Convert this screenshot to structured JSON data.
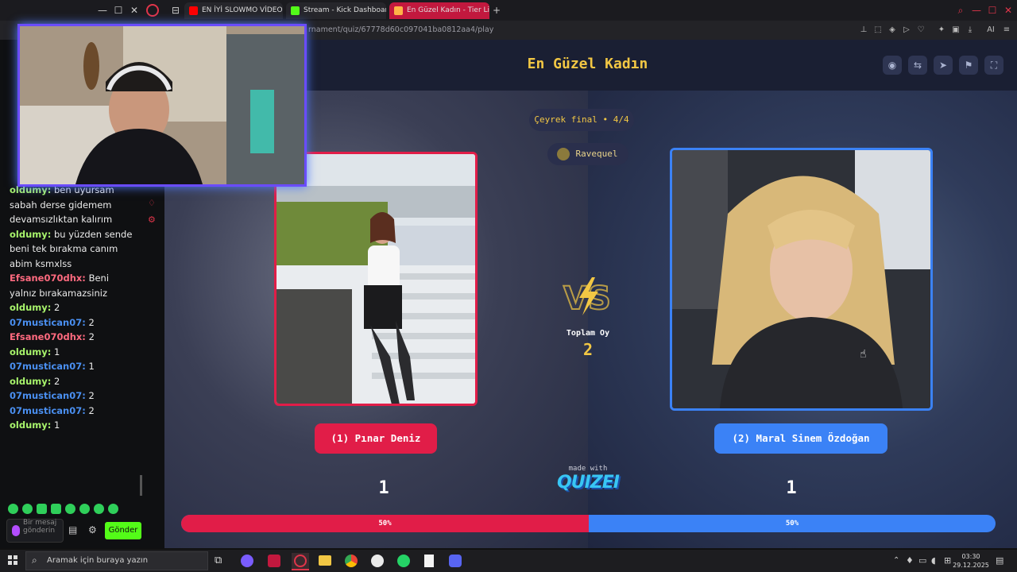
{
  "browser": {
    "tabs": [
      {
        "label": "EN İYİ SLOWMO VİDEOLA",
        "icon_color": "#ff0000"
      },
      {
        "label": "Stream - Kick Dashboard",
        "icon_color": "#53fc18"
      },
      {
        "label": "En Güzel Kadın - Tier List,",
        "icon_color": "#e11d48"
      }
    ],
    "url": "rnament/quiz/67778d60c097041ba0812aa4/play",
    "ai_label": "AI"
  },
  "quiz": {
    "title": "En Güzel Kadın",
    "round_label": "Çeyrek final • 4/4",
    "user_label": "Ravequel",
    "vs_label": "VS",
    "total_votes_label": "Toplam Oy",
    "total_votes": "2",
    "left": {
      "name": "(1) Pınar Deniz",
      "votes": "1",
      "percent": "50%",
      "color": "#e11d48"
    },
    "right": {
      "name": "(2) Maral Sinem Özdoğan",
      "votes": "1",
      "percent": "50%",
      "color": "#3b82f6"
    },
    "made_with": "made with",
    "brand": "QUIZEI",
    "progress_left_fraction": 0.5
  },
  "chat": {
    "messages": [
      {
        "user": "oldumy:",
        "text": "ben uyursam",
        "color": "green"
      },
      {
        "user": "",
        "text": "sabah derse gidemem",
        "color": "green"
      },
      {
        "user": "",
        "text": "devamsızlıktan kalırım",
        "color": "green"
      },
      {
        "user": "oldumy:",
        "text": "bu yüzden sende",
        "color": "green"
      },
      {
        "user": "",
        "text": "beni tek bırakma canım",
        "color": "green"
      },
      {
        "user": "",
        "text": "abim ksmxlss",
        "color": "green"
      },
      {
        "user": "Efsane070dhx:",
        "text": "Beni",
        "color": "red"
      },
      {
        "user": "",
        "text": "yalnız bırakamazsiniz",
        "color": "red"
      },
      {
        "user": "oldumy:",
        "text": "2",
        "color": "green"
      },
      {
        "user": "07mustican07:",
        "text": "2",
        "color": "blue"
      },
      {
        "user": "Efsane070dhx:",
        "text": "2",
        "color": "red"
      },
      {
        "user": "oldumy:",
        "text": "1",
        "color": "green"
      },
      {
        "user": "07mustican07:",
        "text": "1",
        "color": "blue"
      },
      {
        "user": "oldumy:",
        "text": "2",
        "color": "green"
      },
      {
        "user": "07mustican07:",
        "text": "2",
        "color": "blue"
      },
      {
        "user": "07mustican07:",
        "text": "2",
        "color": "blue"
      },
      {
        "user": "oldumy:",
        "text": "1",
        "color": "green"
      }
    ],
    "input_placeholder": "Bir mesaj gönderin",
    "send_label": "Gönder"
  },
  "taskbar": {
    "search_placeholder": "Aramak için buraya yazın",
    "time": "03:30",
    "date": "29.12.2025"
  }
}
